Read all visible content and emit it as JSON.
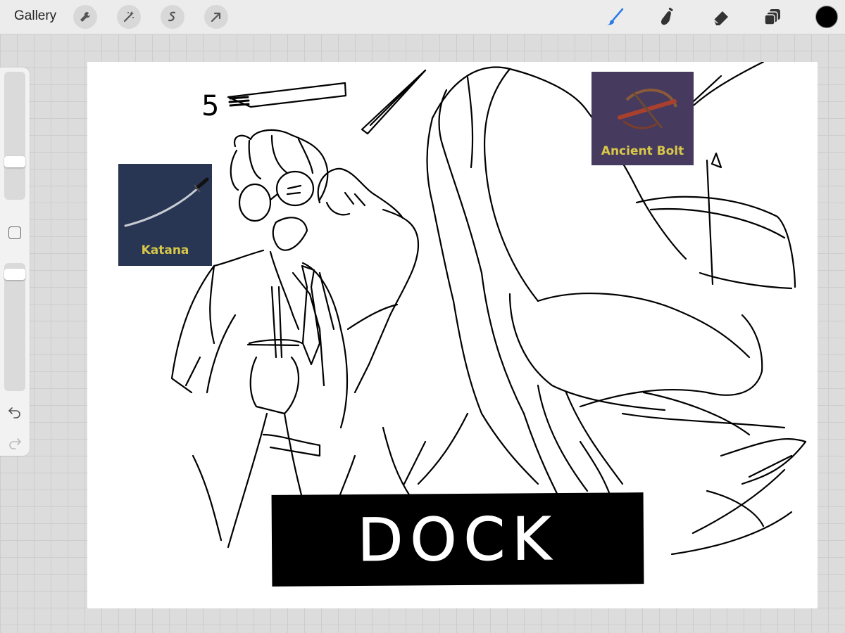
{
  "toolbar": {
    "gallery_label": "Gallery",
    "actions": [
      "wrench-icon",
      "magic-wand-icon",
      "selection-icon",
      "transform-arrow-icon"
    ],
    "tools": [
      "brush-icon",
      "smudge-icon",
      "eraser-icon",
      "layers-icon"
    ],
    "active_tool": "brush",
    "current_color": "#000000",
    "accent_color": "#2a7ae8"
  },
  "sidebar": {
    "brush_size": 0.28,
    "opacity": 0.95,
    "undo_icon": "undo-icon",
    "redo_icon": "redo-icon"
  },
  "canvas": {
    "katana_label": "Katana",
    "katana_bg": "#283553",
    "bolt_label": "Ancient Bolt",
    "bolt_bg": "#463a5e",
    "label_color": "#d8c84a",
    "dock_text": "DOCK",
    "doodle_number": "5"
  }
}
